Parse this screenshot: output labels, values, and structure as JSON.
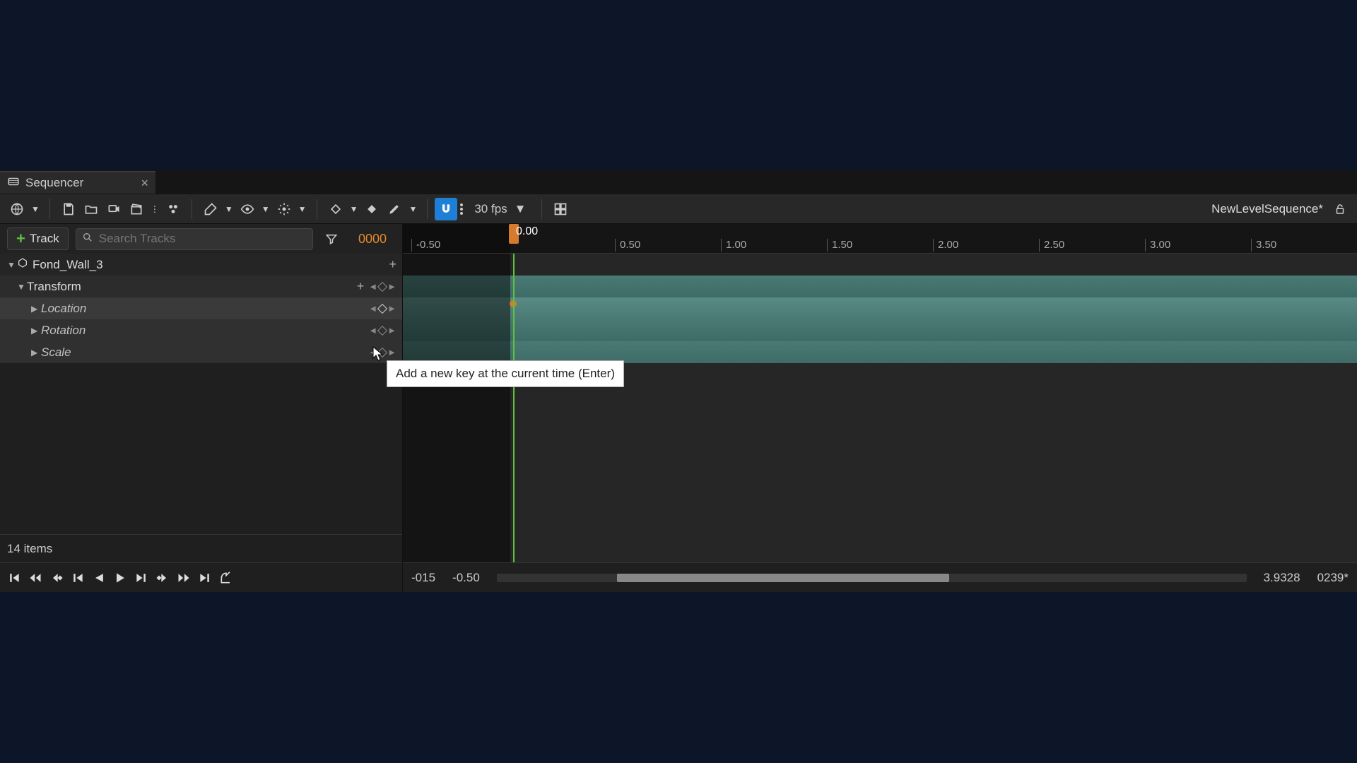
{
  "tab": {
    "title": "Sequencer",
    "close": "×"
  },
  "toolbar": {
    "fps_label": "30 fps",
    "sequence_name": "NewLevelSequence*"
  },
  "outliner": {
    "add_track_label": "Track",
    "search_placeholder": "Search Tracks",
    "frame_display": "0000",
    "items_footer": "14 items",
    "rows": {
      "actor": "Fond_Wall_3",
      "transform": "Transform",
      "location": "Location",
      "rotation": "Rotation",
      "scale": "Scale"
    }
  },
  "ruler": {
    "playhead_time": "0.00",
    "ticks": [
      "-0.50",
      "0.50",
      "1.00",
      "1.50",
      "2.00",
      "2.50",
      "3.00",
      "3.50"
    ]
  },
  "scrub": {
    "start_frame": "-015",
    "start_time": "-0.50",
    "end_time": "3.9328",
    "end_frame": "0239*"
  },
  "tooltip_text": "Add a new key at the current time (Enter)"
}
